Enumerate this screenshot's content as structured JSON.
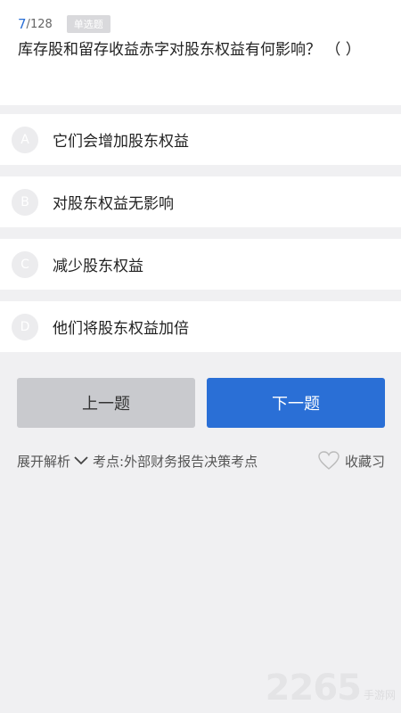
{
  "progress": {
    "current": "7",
    "separator": "/",
    "total": "128"
  },
  "question_type": "单选题",
  "question": {
    "text": "库存股和留存收益赤字对股东权益有何影响？ （ ）"
  },
  "options": [
    {
      "letter": "A",
      "text": "它们会增加股东权益"
    },
    {
      "letter": "B",
      "text": "对股东权益无影响"
    },
    {
      "letter": "C",
      "text": "减少股东权益"
    },
    {
      "letter": "D",
      "text": "他们将股东权益加倍"
    }
  ],
  "nav": {
    "prev_label": "上一题",
    "next_label": "下一题"
  },
  "analysis": {
    "expand_label": "展开解析",
    "exam_point": "考点:外部财务报告决策考点"
  },
  "favorite_label": "收藏习",
  "watermark": {
    "number": "2265",
    "text": "手游网"
  },
  "colors": {
    "accent": "#2a6fd6",
    "background": "#f0f0f2",
    "prev_button": "#c9cace"
  }
}
